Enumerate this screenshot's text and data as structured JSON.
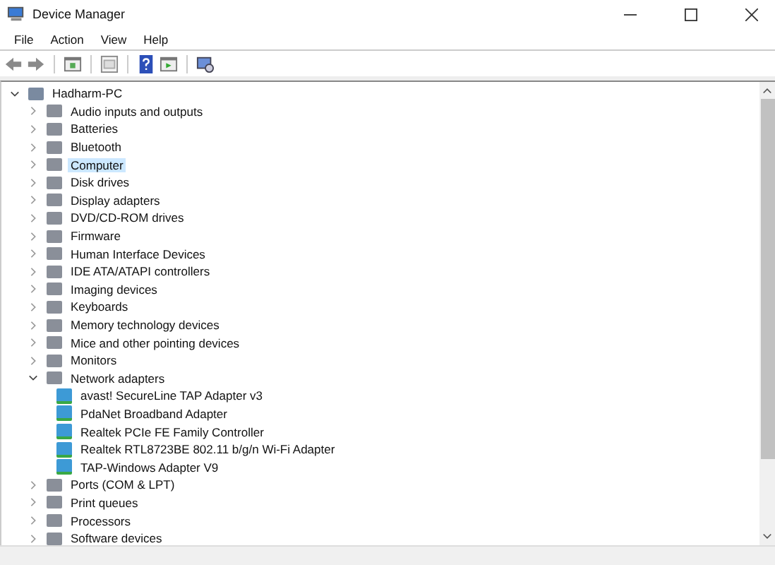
{
  "window": {
    "title": "Device Manager"
  },
  "menu": [
    "File",
    "Action",
    "View",
    "Help"
  ],
  "tree": {
    "root": {
      "label": "Hadharm-PC",
      "expanded": true,
      "selected": false,
      "children": [
        {
          "label": "Audio inputs and outputs",
          "expanded": false,
          "selected": false
        },
        {
          "label": "Batteries",
          "expanded": false,
          "selected": false
        },
        {
          "label": "Bluetooth",
          "expanded": false,
          "selected": false
        },
        {
          "label": "Computer",
          "expanded": false,
          "selected": true
        },
        {
          "label": "Disk drives",
          "expanded": false,
          "selected": false
        },
        {
          "label": "Display adapters",
          "expanded": false,
          "selected": false
        },
        {
          "label": "DVD/CD-ROM drives",
          "expanded": false,
          "selected": false
        },
        {
          "label": "Firmware",
          "expanded": false,
          "selected": false
        },
        {
          "label": "Human Interface Devices",
          "expanded": false,
          "selected": false
        },
        {
          "label": "IDE ATA/ATAPI controllers",
          "expanded": false,
          "selected": false
        },
        {
          "label": "Imaging devices",
          "expanded": false,
          "selected": false
        },
        {
          "label": "Keyboards",
          "expanded": false,
          "selected": false
        },
        {
          "label": "Memory technology devices",
          "expanded": false,
          "selected": false
        },
        {
          "label": "Mice and other pointing devices",
          "expanded": false,
          "selected": false
        },
        {
          "label": "Monitors",
          "expanded": false,
          "selected": false
        },
        {
          "label": "Network adapters",
          "expanded": true,
          "selected": false,
          "children": [
            {
              "label": "avast! SecureLine TAP Adapter v3",
              "selected": false
            },
            {
              "label": "PdaNet Broadband Adapter",
              "selected": false
            },
            {
              "label": "Realtek PCIe FE Family Controller",
              "selected": false
            },
            {
              "label": "Realtek RTL8723BE 802.11 b/g/n Wi-Fi Adapter",
              "selected": false
            },
            {
              "label": "TAP-Windows Adapter V9",
              "selected": false
            }
          ]
        },
        {
          "label": "Ports (COM & LPT)",
          "expanded": false,
          "selected": false
        },
        {
          "label": "Print queues",
          "expanded": false,
          "selected": false
        },
        {
          "label": "Processors",
          "expanded": false,
          "selected": false
        },
        {
          "label": "Software devices",
          "expanded": false,
          "selected": false
        }
      ]
    }
  }
}
